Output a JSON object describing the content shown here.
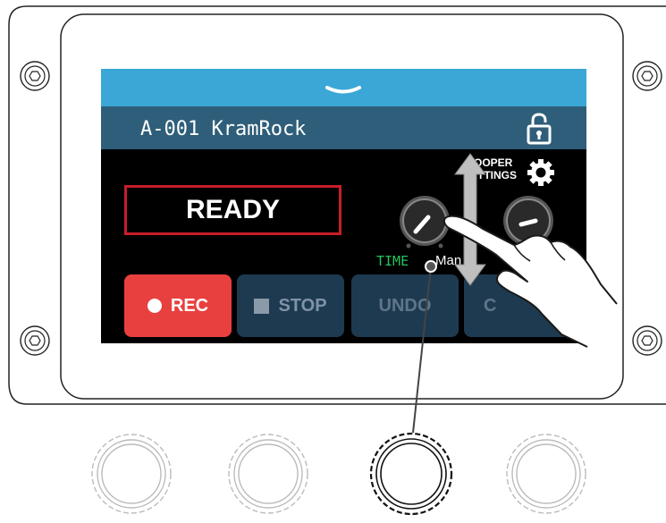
{
  "patch": {
    "name": "A-001 KramRock"
  },
  "status": {
    "text": "READY"
  },
  "looper": {
    "settings_label_line1": "LOOPER",
    "settings_label_line2": "SETTINGS"
  },
  "knob_labels": {
    "time": "TIME",
    "mode": "Man"
  },
  "buttons": {
    "rec": "REC",
    "stop": "STOP",
    "undo": "UNDO",
    "extra": "C"
  },
  "icons": [
    "chevron-down-icon",
    "lock-icon",
    "gear-icon",
    "rec-dot-icon",
    "stop-square-icon",
    "hand-gesture-icon",
    "swipe-arrow-icon"
  ],
  "colors": {
    "topbar": "#3aa7d6",
    "titlebar": "#2f5e7a",
    "rec": "#e8403f",
    "ready_border": "#c81e2a",
    "time_label": "#22c55e",
    "button_dark": "#1e3a50"
  }
}
